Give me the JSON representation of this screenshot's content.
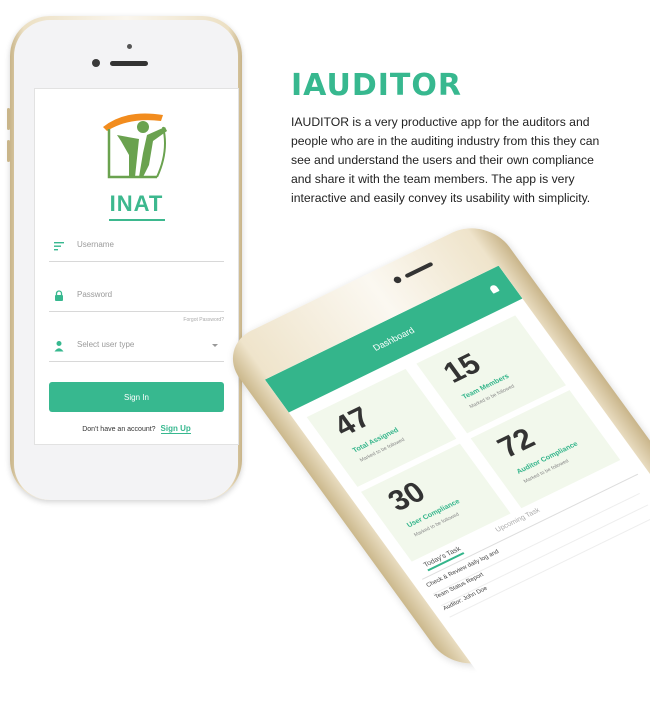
{
  "login_screen": {
    "brand_name": "INAT",
    "username_placeholder": "Username",
    "password_placeholder": "Password",
    "forgot_password": "Forgot Password?",
    "user_type_placeholder": "Select user type",
    "sign_in_label": "Sign In",
    "no_account_text": "Don't have an account?",
    "sign_up_label": "Sign Up"
  },
  "hero": {
    "title": "IAUDITOR",
    "description": "IAUDITOR is a very productive app for the auditors and people who are in the auditing industry from this they can see and understand the users and their own compliance and share it with the team members. The app is very interactive and easily convey its usability with simplicity."
  },
  "dashboard_screen": {
    "title": "Dashboard",
    "tiles": [
      {
        "value": "47",
        "label": "Total Assigned",
        "sub": "Marked to be followed"
      },
      {
        "value": "15",
        "label": "Team Members",
        "sub": "Marked to be followed"
      },
      {
        "value": "30",
        "label": "User Compliance",
        "sub": "Marked to be followed"
      },
      {
        "value": "72",
        "label": "Auditor Compliance",
        "sub": "Marked to be followed"
      }
    ],
    "tabs": [
      "Today's Task",
      "Upcoming Task"
    ],
    "list_items": [
      "Check & Review daily log and",
      "Team Status Report",
      "Auditor: John Doe"
    ]
  },
  "colors": {
    "accent": "#37b88f",
    "logo_orange": "#f28c1e",
    "logo_green": "#6aa24f"
  }
}
